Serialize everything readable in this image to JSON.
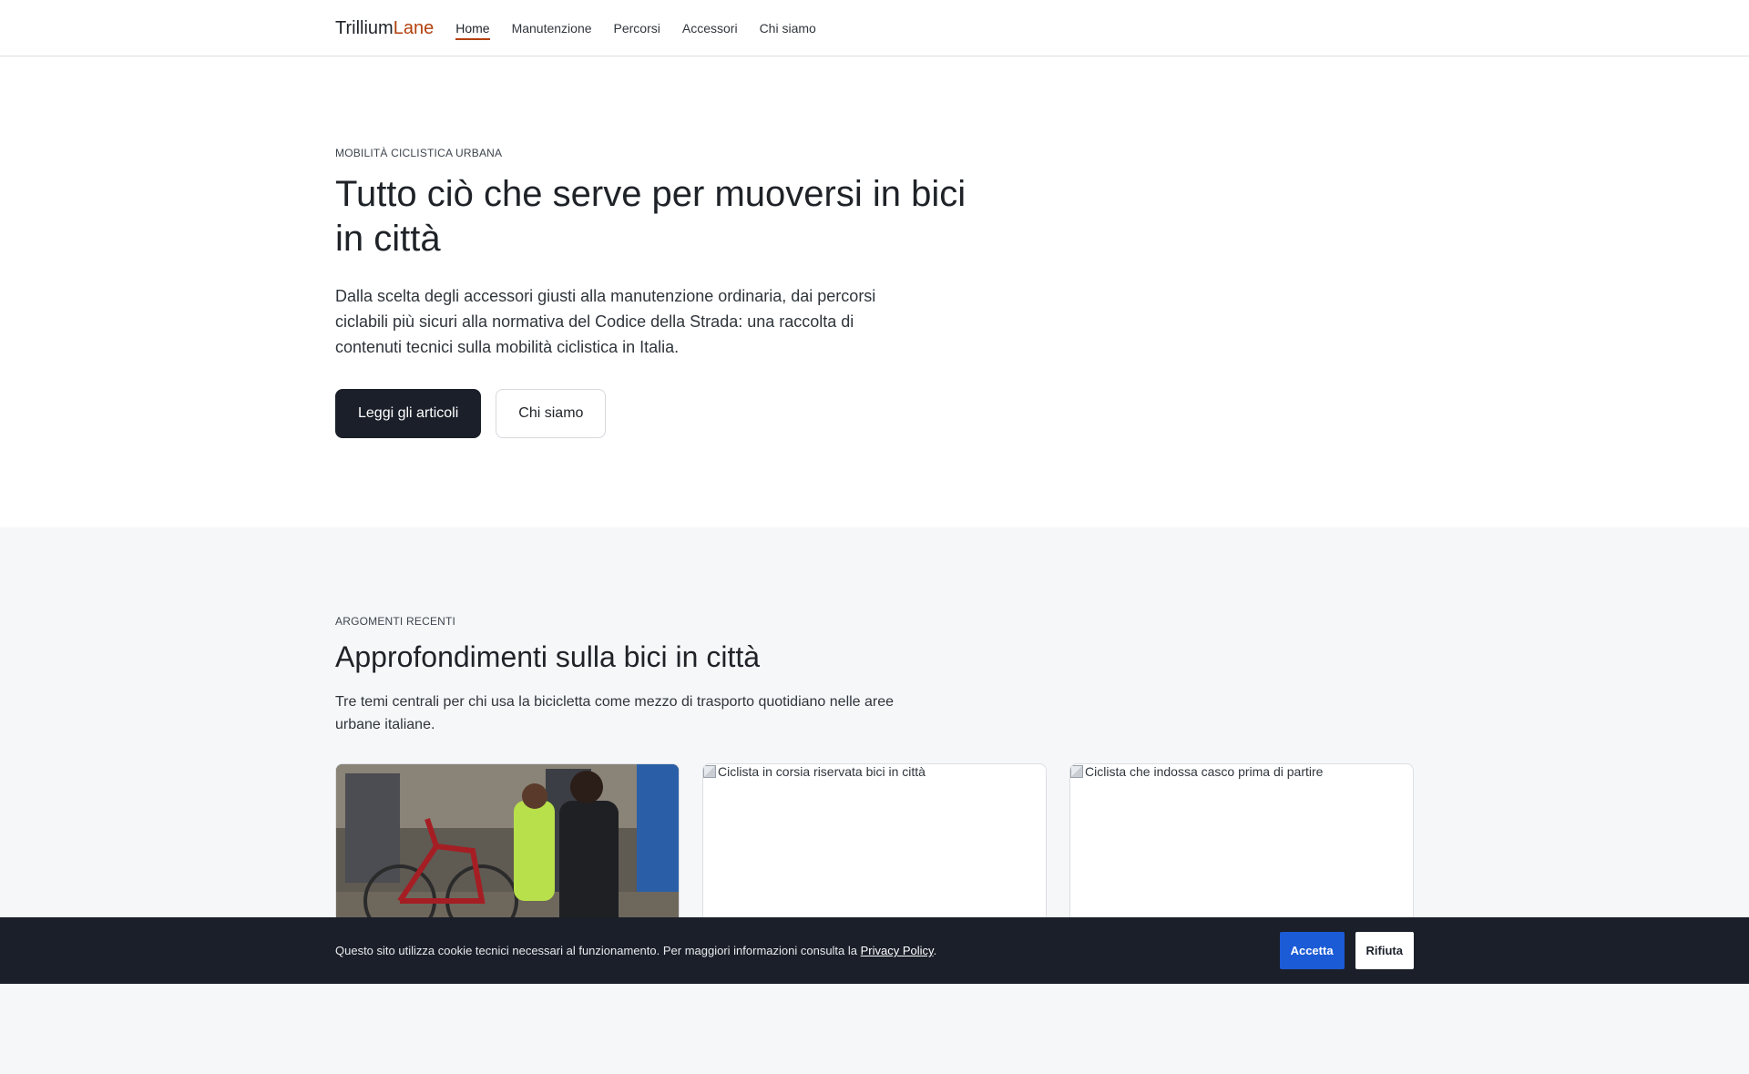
{
  "header": {
    "logo_main": "Trillium",
    "logo_accent": "Lane",
    "nav": [
      {
        "label": "Home",
        "active": true
      },
      {
        "label": "Manutenzione"
      },
      {
        "label": "Percorsi"
      },
      {
        "label": "Accessori"
      },
      {
        "label": "Chi siamo"
      }
    ]
  },
  "hero": {
    "eyebrow": "MOBILITÀ CICLISTICA URBANA",
    "title": "Tutto ciò che serve per muoversi in bici in città",
    "lead": "Dalla scelta degli accessori giusti alla manutenzione ordinaria, dai percorsi ciclabili più sicuri alla normativa del Codice della Strada: una raccolta di contenuti tecnici sulla mobilità ciclistica in Italia.",
    "primary_button": "Leggi gli articoli",
    "secondary_button": "Chi siamo"
  },
  "topics": {
    "eyebrow": "ARGOMENTI RECENTI",
    "title": "Approfondimenti sulla bici in città",
    "description": "Tre temi centrali per chi usa la bicicletta come mezzo di trasporto quotidiano nelle aree urbane italiane.",
    "cards": [
      {
        "type": "photo"
      },
      {
        "type": "broken",
        "alt": "Ciclista in corsia riservata bici in città"
      },
      {
        "type": "broken",
        "alt": "Ciclista che indossa casco prima di partire"
      }
    ]
  },
  "cookie": {
    "text": "Questo sito utilizza cookie tecnici necessari al funzionamento. Per maggiori informazioni consulta la",
    "link": "Privacy Policy",
    "after_link": ".",
    "accept": "Accetta",
    "reject": "Rifiuta"
  },
  "colors": {
    "accent": "#b2400d",
    "dark": "#1a1f29",
    "accept_blue": "#1c5bd6",
    "section_bg": "#f6f7f9"
  }
}
